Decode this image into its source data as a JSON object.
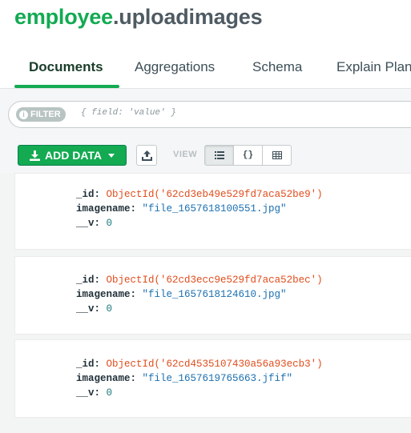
{
  "header": {
    "db": "employee",
    "collection": ".uploadimages"
  },
  "tabs": [
    {
      "label": "Documents",
      "active": true
    },
    {
      "label": "Aggregations",
      "active": false
    },
    {
      "label": "Schema",
      "active": false
    },
    {
      "label": "Explain Plan",
      "active": false
    }
  ],
  "filter": {
    "pill_label": "FILTER",
    "placeholder": "{ field: 'value' }"
  },
  "toolbar": {
    "add_data_label": "ADD DATA",
    "view_label": "VIEW"
  },
  "documents": [
    {
      "id_key": "_id:",
      "id_value": "ObjectId('62cd3eb49e529fd7aca52be9')",
      "name_key": "imagename:",
      "name_value": "\"file_1657618100551.jpg\"",
      "v_key": "__v:",
      "v_value": "0"
    },
    {
      "id_key": "_id:",
      "id_value": "ObjectId('62cd3ecc9e529fd7aca52bec')",
      "name_key": "imagename:",
      "name_value": "\"file_1657618124610.jpg\"",
      "v_key": "__v:",
      "v_value": "0"
    },
    {
      "id_key": "_id:",
      "id_value": "ObjectId('62cd4535107430a56a93ecb3')",
      "name_key": "imagename:",
      "name_value": "\"file_1657619765663.jfif\"",
      "v_key": "__v:",
      "v_value": "0"
    }
  ],
  "colors": {
    "accent": "#13aa52",
    "objectid": "#e04d1c",
    "string": "#1b6fb0",
    "number": "#1a7a7a"
  }
}
